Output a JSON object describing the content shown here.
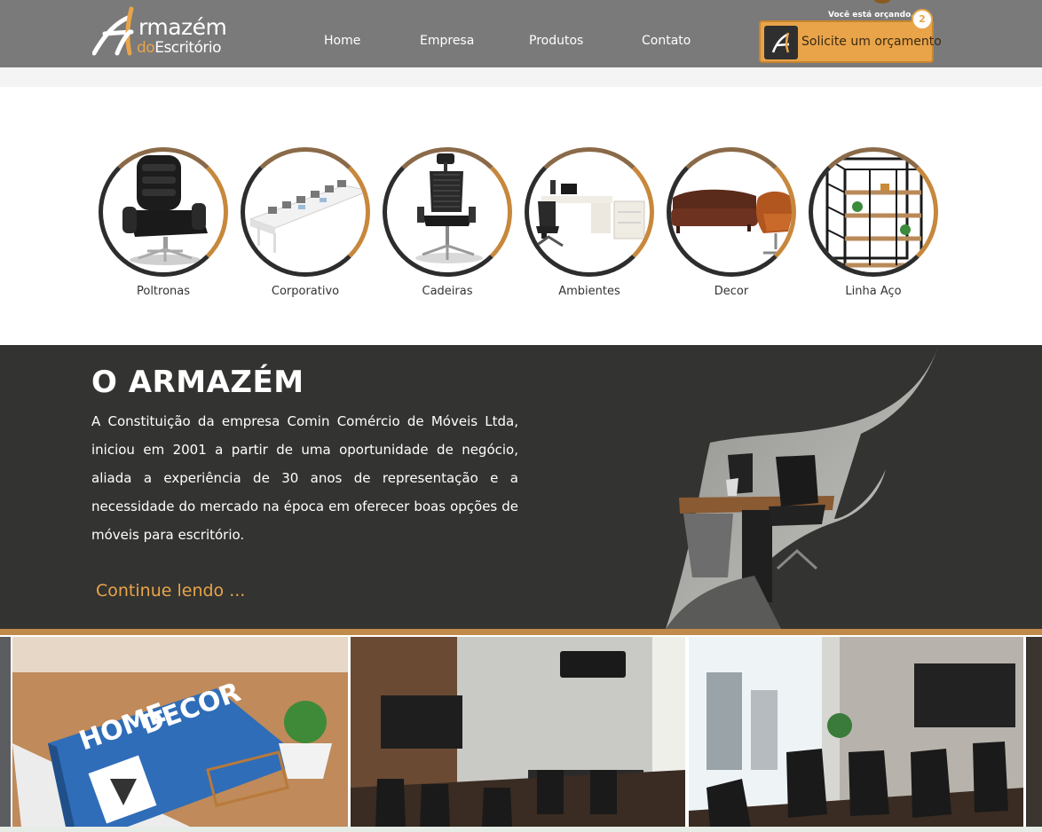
{
  "header": {
    "logo": {
      "line1": "rmazém",
      "line2_do": "do",
      "line2_rest": "Escritório"
    },
    "nav": [
      {
        "label": "Home"
      },
      {
        "label": "Empresa"
      },
      {
        "label": "Produtos"
      },
      {
        "label": "Contato"
      }
    ],
    "quote_hint": "Você está orçando...",
    "quote_count": "2",
    "quote_button": "Solicite um orçamento"
  },
  "categories": [
    {
      "label": "Poltronas",
      "icon": "office-armchair"
    },
    {
      "label": "Corporativo",
      "icon": "workstation-desks"
    },
    {
      "label": "Cadeiras",
      "icon": "mesh-office-chair"
    },
    {
      "label": "Ambientes",
      "icon": "desk-setup"
    },
    {
      "label": "Decor",
      "icon": "sofa-and-egg-chair"
    },
    {
      "label": "Linha Aço",
      "icon": "steel-shelf"
    }
  ],
  "about": {
    "title": "O ARMAZÉM",
    "text": "A Constituição da empresa Comin Comércio de Móveis Ltda, iniciou em 2001 a partir de uma oportunidade de negócio, aliada a experiência de 30 anos de representação e a necessidade do mercado na época em oferecer boas opções de móveis para escritório.",
    "more": "Continue lendo ..."
  },
  "colors": {
    "header_bg": "#7a7a7a",
    "accent": "#e9a44a",
    "dark_section": "#333331"
  }
}
